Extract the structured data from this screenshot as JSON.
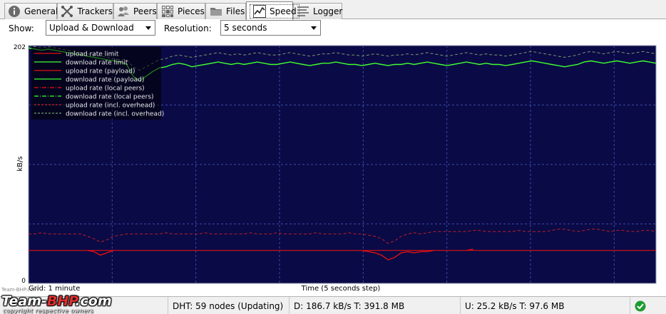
{
  "tabs": [
    {
      "label": "General",
      "icon": "info-icon"
    },
    {
      "label": "Trackers",
      "icon": "trackers-icon"
    },
    {
      "label": "Peers",
      "icon": "peers-icon"
    },
    {
      "label": "Pieces",
      "icon": "pieces-icon"
    },
    {
      "label": "Files",
      "icon": "folder-icon"
    },
    {
      "label": "Speed",
      "icon": "speed-graph-icon",
      "active": true
    },
    {
      "label": "Logger",
      "icon": "logger-icon"
    }
  ],
  "toolbar": {
    "show_label": "Show:",
    "show_value": "Upload & Download",
    "resolution_label": "Resolution:",
    "resolution_value": "5 seconds"
  },
  "chart_data": {
    "type": "line",
    "ylabel": "kB/s",
    "xlabel": "Time (5 seconds step)",
    "grid_note": "Grid: 1 minute",
    "ylim": [
      0,
      202
    ],
    "y_ticks": [
      "202",
      "0"
    ],
    "grid": true,
    "legend_placement": "top-left",
    "background": "#0a0a46",
    "colors": {
      "upload": "#e01010",
      "download": "#40ff30",
      "upload_overhead": "#c02020",
      "download_overhead": "#7a9a6a"
    },
    "legend": [
      {
        "name": "upload rate limit",
        "color": "#e01010",
        "style": "solid"
      },
      {
        "name": "download rate limit",
        "color": "#40ff30",
        "style": "solid"
      },
      {
        "name": "upload rate (payload)",
        "color": "#e01010",
        "style": "solid"
      },
      {
        "name": "download rate (payload)",
        "color": "#40ff30",
        "style": "solid"
      },
      {
        "name": "upload rate (local peers)",
        "color": "#e01010",
        "style": "dashdot"
      },
      {
        "name": "download rate (local peers)",
        "color": "#40ff30",
        "style": "dashdot"
      },
      {
        "name": "upload rate (incl. overhead)",
        "color": "#c02020",
        "style": "dashed"
      },
      {
        "name": "download rate (incl. overhead)",
        "color": "#7a9a6a",
        "style": "dashed"
      }
    ],
    "upload_rate_limit": 28,
    "series": [
      {
        "name": "download rate (payload)",
        "key": "download",
        "values": [
          200,
          199,
          198,
          199,
          198,
          197,
          196,
          195,
          194,
          193,
          192,
          191,
          190,
          189,
          188,
          186,
          176,
          172,
          176,
          180,
          183,
          184,
          186,
          187,
          186,
          184,
          185,
          186,
          187,
          188,
          187,
          186,
          187,
          186,
          187,
          188,
          187,
          186,
          186,
          187,
          188,
          187,
          186,
          185,
          186,
          187,
          187,
          188,
          187,
          186,
          186,
          185,
          186,
          187,
          186,
          185,
          186,
          186,
          187,
          186,
          187,
          188,
          187,
          186,
          185,
          186,
          187,
          188,
          187,
          186,
          187,
          186,
          186,
          185,
          186,
          187,
          188,
          189,
          188,
          187,
          186,
          185,
          184,
          185,
          186,
          188,
          189,
          188,
          187,
          188,
          189,
          188,
          187,
          188,
          189,
          188,
          187
        ]
      },
      {
        "name": "download rate (incl. overhead)",
        "key": "download_overhead",
        "values": [
          202,
          201,
          200,
          201,
          200,
          199,
          198,
          197,
          196,
          195,
          194,
          193,
          192,
          191,
          190,
          190,
          184,
          181,
          184,
          187,
          190,
          191,
          193,
          194,
          193,
          192,
          193,
          194,
          195,
          196,
          195,
          194,
          195,
          194,
          195,
          196,
          195,
          194,
          194,
          195,
          196,
          195,
          194,
          193,
          194,
          195,
          195,
          196,
          195,
          194,
          194,
          193,
          194,
          195,
          194,
          193,
          194,
          194,
          195,
          194,
          195,
          196,
          195,
          194,
          193,
          194,
          195,
          196,
          195,
          194,
          195,
          194,
          194,
          193,
          194,
          195,
          196,
          197,
          196,
          195,
          194,
          193,
          192,
          193,
          194,
          196,
          197,
          196,
          195,
          196,
          197,
          196,
          195,
          196,
          197,
          196,
          195
        ]
      },
      {
        "name": "upload rate (payload)",
        "key": "upload",
        "values": [
          null,
          null,
          null,
          null,
          null,
          null,
          null,
          null,
          null,
          28,
          27,
          24,
          26,
          28,
          null,
          null,
          null,
          null,
          null,
          null,
          null,
          null,
          null,
          null,
          null,
          null,
          null,
          null,
          null,
          null,
          null,
          null,
          null,
          null,
          null,
          null,
          null,
          null,
          null,
          null,
          null,
          null,
          null,
          null,
          null,
          28,
          null,
          null,
          null,
          null,
          null,
          28,
          27,
          26,
          24,
          20,
          22,
          26,
          27,
          26,
          27,
          27,
          28,
          null,
          null,
          null,
          null,
          28,
          29,
          null,
          null,
          null,
          null,
          null,
          null,
          null,
          null,
          null,
          null,
          null,
          null,
          null,
          null,
          null,
          null,
          null,
          null,
          null,
          null,
          null,
          null,
          null,
          null,
          null,
          null,
          null,
          null
        ]
      },
      {
        "name": "upload rate (incl. overhead)",
        "key": "upload_overhead",
        "values": [
          42,
          42,
          43,
          42,
          42,
          42,
          42,
          42,
          42,
          40,
          38,
          35,
          37,
          40,
          41,
          42,
          42,
          42,
          42,
          42,
          42,
          43,
          42,
          42,
          42,
          42,
          42,
          43,
          42,
          42,
          42,
          42,
          42,
          42,
          43,
          42,
          42,
          42,
          43,
          42,
          42,
          42,
          42,
          42,
          43,
          42,
          42,
          42,
          42,
          43,
          42,
          42,
          41,
          40,
          38,
          34,
          36,
          40,
          42,
          43,
          42,
          43,
          44,
          44,
          44,
          44,
          44,
          44,
          45,
          45,
          44,
          44,
          44,
          44,
          44,
          45,
          44,
          44,
          44,
          44,
          45,
          46,
          46,
          45,
          44,
          45,
          46,
          46,
          45,
          44,
          45,
          45,
          44,
          44,
          45,
          45,
          44
        ]
      }
    ]
  },
  "status": {
    "dht": "DHT: 59 nodes (Updating)",
    "download": "D: 186.7 kB/s T: 391.8 MB",
    "upload": "U: 25.2 kB/s T: 97.6 MB"
  },
  "watermark": {
    "brand_a": "Team-",
    "brand_b": "BHP",
    "brand_c": ".com",
    "sub": "copyright respective owners",
    "top": "Team-BHP.com"
  }
}
